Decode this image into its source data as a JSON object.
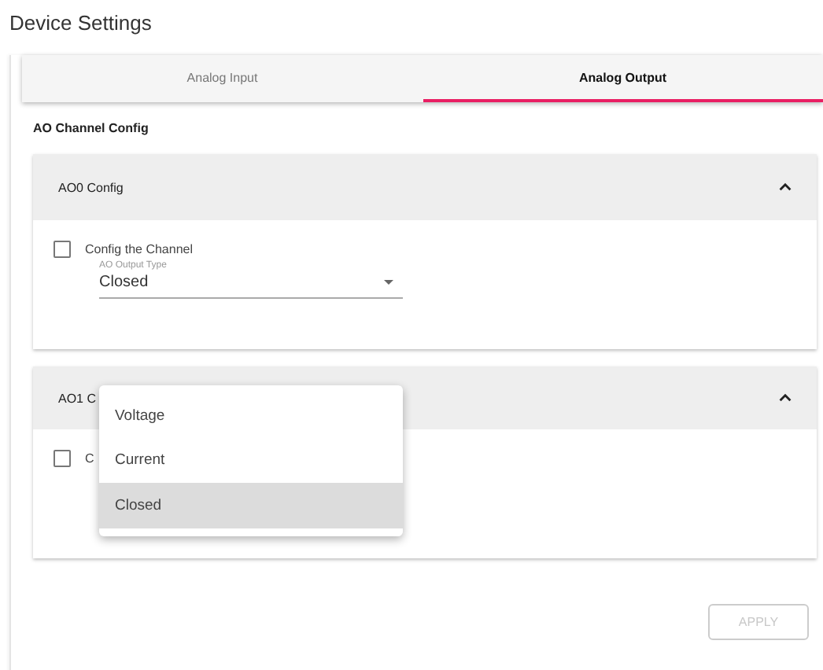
{
  "title": "Device Settings",
  "tabs": [
    {
      "label": "Analog Input",
      "selected": false
    },
    {
      "label": "Analog Output",
      "selected": true
    }
  ],
  "section_title": "AO Channel Config",
  "panels": [
    {
      "title": "AO0 Config",
      "expanded": true,
      "checkbox": {
        "label": "Config the Channel",
        "checked": false
      },
      "select": {
        "label": "AO Output Type",
        "value": "Closed"
      }
    },
    {
      "title": "AO1 C",
      "expanded": true,
      "checkbox": {
        "label": "C",
        "checked": false
      },
      "menu": {
        "options": [
          {
            "label": "Voltage",
            "selected": false
          },
          {
            "label": "Current",
            "selected": false
          },
          {
            "label": "Closed",
            "selected": true
          }
        ]
      }
    }
  ],
  "apply_button": {
    "label": "APPLY",
    "disabled": true
  }
}
